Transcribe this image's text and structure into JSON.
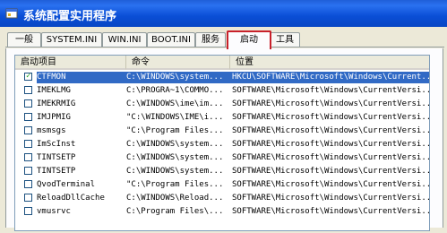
{
  "window": {
    "title": "系统配置实用程序"
  },
  "tabs": [
    "一般",
    "SYSTEM.INI",
    "WIN.INI",
    "BOOT.INI",
    "服务",
    "启动",
    "工具"
  ],
  "active_tab": "启动",
  "columns": [
    "启动项目",
    "命令",
    "位置"
  ],
  "rows": [
    {
      "checked": true,
      "selected": true,
      "name": "CTFMON",
      "command": "C:\\WINDOWS\\system...",
      "location": "HKCU\\SOFTWARE\\Microsoft\\Windows\\Current..."
    },
    {
      "checked": false,
      "selected": false,
      "name": "IMEKLMG",
      "command": "C:\\PROGRA~1\\COMMO...",
      "location": "SOFTWARE\\Microsoft\\Windows\\CurrentVersi..."
    },
    {
      "checked": false,
      "selected": false,
      "name": "IMEKRMIG",
      "command": "C:\\WINDOWS\\ime\\im...",
      "location": "SOFTWARE\\Microsoft\\Windows\\CurrentVersi..."
    },
    {
      "checked": false,
      "selected": false,
      "name": "IMJPMIG",
      "command": "\"C:\\WINDOWS\\IME\\i...",
      "location": "SOFTWARE\\Microsoft\\Windows\\CurrentVersi..."
    },
    {
      "checked": false,
      "selected": false,
      "name": "msmsgs",
      "command": "\"C:\\Program Files...",
      "location": "SOFTWARE\\Microsoft\\Windows\\CurrentVersi..."
    },
    {
      "checked": false,
      "selected": false,
      "name": "ImScInst",
      "command": "C:\\WINDOWS\\system...",
      "location": "SOFTWARE\\Microsoft\\Windows\\CurrentVersi..."
    },
    {
      "checked": false,
      "selected": false,
      "name": "TINTSETP",
      "command": "C:\\WINDOWS\\system...",
      "location": "SOFTWARE\\Microsoft\\Windows\\CurrentVersi..."
    },
    {
      "checked": false,
      "selected": false,
      "name": "TINTSETP",
      "command": "C:\\WINDOWS\\system...",
      "location": "SOFTWARE\\Microsoft\\Windows\\CurrentVersi..."
    },
    {
      "checked": false,
      "selected": false,
      "name": "QvodTerminal",
      "command": "\"C:\\Program Files...",
      "location": "SOFTWARE\\Microsoft\\Windows\\CurrentVersi..."
    },
    {
      "checked": false,
      "selected": false,
      "name": "ReloadDllCache",
      "command": "C:\\WINDOWS\\Reload...",
      "location": "SOFTWARE\\Microsoft\\Windows\\CurrentVersi..."
    },
    {
      "checked": false,
      "selected": false,
      "name": "vmusrvc",
      "command": "C:\\Program Files\\...",
      "location": "SOFTWARE\\Microsoft\\Windows\\CurrentVersi..."
    }
  ],
  "colors": {
    "selection": "#316ac5",
    "highlight_border": "#c8202a",
    "titlebar": "#0a4ed6"
  },
  "icons": {
    "app": "window-icon",
    "check": "checkmark-icon"
  }
}
